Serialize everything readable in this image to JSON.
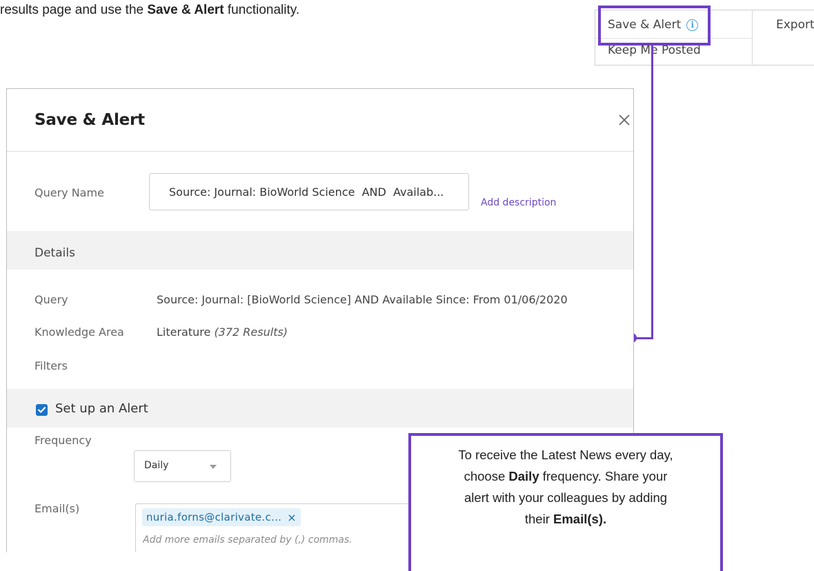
{
  "intro": {
    "prefix": "results page and use the ",
    "bold": "Save & Alert",
    "suffix": " functionality."
  },
  "menu": {
    "save_alert": "Save & Alert",
    "info_icon": "info-icon",
    "keep_posted": "Keep Me Posted",
    "export": "Export"
  },
  "modal": {
    "title": "Save & Alert",
    "close_icon": "close-icon",
    "query_name_label": "Query Name",
    "query_name_value": "Source: Journal: BioWorld Science  AND  Availab...",
    "add_description": "Add description",
    "details_title": "Details",
    "details": {
      "query_label": "Query",
      "query_value": "Source: Journal: [BioWorld Science] AND Available Since: From 01/06/2020",
      "knowledge_area_label": "Knowledge Area",
      "knowledge_area_value": "Literature",
      "knowledge_area_count": "(372 Results)",
      "filters_label": "Filters"
    },
    "alert_checkbox_label": "Set up an Alert",
    "alert_checked": true,
    "frequency_label": "Frequency",
    "frequency_value": "Daily",
    "emails_label": "Email(s)",
    "email_chip": "nuria.forns@clarivate.c...",
    "email_chip_remove": "×",
    "email_placeholder": "Add more emails separated by (,) commas."
  },
  "callout": {
    "line1": "To receive the Latest News every day,",
    "line2_pre": "choose ",
    "line2_bold": "Daily",
    "line2_post": " frequency. Share your",
    "line3": "alert with your colleagues by adding",
    "line4_pre": "their ",
    "line4_bold": "Email(s)."
  },
  "colors": {
    "highlight": "#6f3fc8",
    "link": "#6a48c4",
    "checkbox": "#1a73c8",
    "chip_bg": "#e3f1fa"
  }
}
